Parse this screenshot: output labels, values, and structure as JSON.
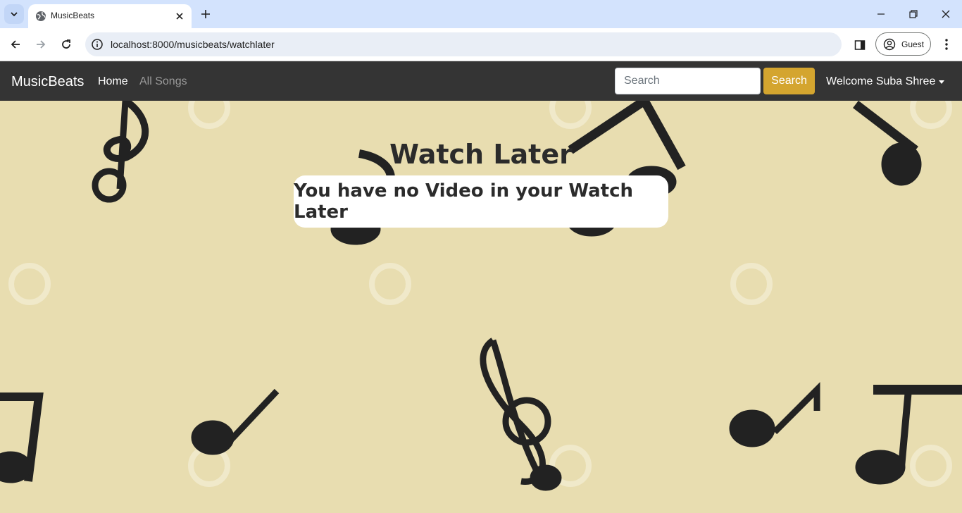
{
  "browser": {
    "tab_title": "MusicBeats",
    "url": "localhost:8000/musicbeats/watchlater",
    "profile_label": "Guest"
  },
  "navbar": {
    "brand": "MusicBeats",
    "links": [
      "Home",
      "All Songs"
    ],
    "search_placeholder": "Search",
    "search_button": "Search",
    "user_menu": "Welcome Suba Shree"
  },
  "main": {
    "title": "Watch Later",
    "empty_message": "You have no Video in your Watch Later"
  },
  "colors": {
    "background": "#e8ddb0",
    "navbar": "#343434",
    "search_button": "#d4a52f",
    "notes": "#222222"
  }
}
